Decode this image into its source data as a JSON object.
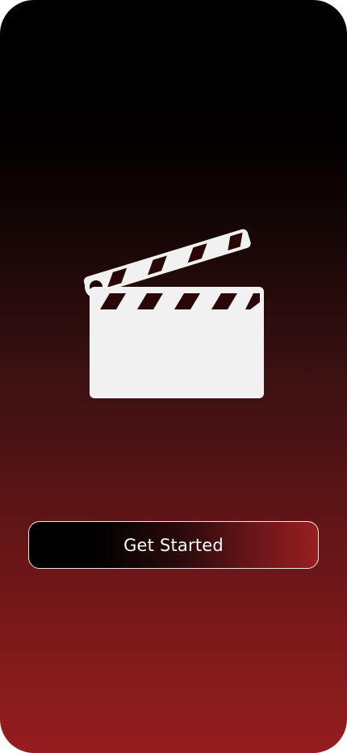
{
  "screen": {
    "gradient_top": "#000000",
    "gradient_bottom": "#951d1f"
  },
  "hero": {
    "icon": "clapperboard-icon",
    "icon_color": "#f2f1f1"
  },
  "cta": {
    "label": "Get Started",
    "border_color": "#efe6e6",
    "accent": "#9a1e21"
  }
}
